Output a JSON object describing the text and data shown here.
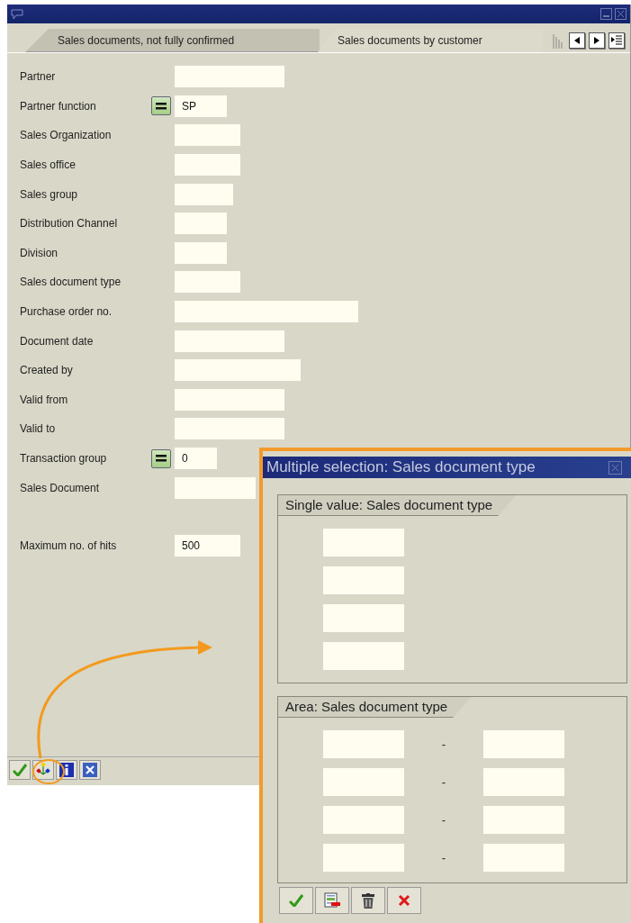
{
  "tabs": [
    {
      "label": "Sales documents, not fully confirmed",
      "selected": false
    },
    {
      "label": "Sales documents by customer",
      "selected": true
    }
  ],
  "fields": [
    {
      "label": "Partner",
      "kind": "plain"
    },
    {
      "label": "Partner function",
      "kind": "option",
      "value": "SP"
    },
    {
      "label": "Sales Organization",
      "kind": "plain"
    },
    {
      "label": "Sales office",
      "kind": "plain"
    },
    {
      "label": "Sales group",
      "kind": "plain"
    },
    {
      "label": "Distribution Channel",
      "kind": "plain"
    },
    {
      "label": "Division",
      "kind": "plain"
    },
    {
      "label": "Sales document type",
      "kind": "plain"
    },
    {
      "label": "Purchase order no.",
      "kind": "plain"
    },
    {
      "label": "Document date",
      "kind": "plain"
    },
    {
      "label": "Created by",
      "kind": "plain"
    },
    {
      "label": "Valid from",
      "kind": "plain"
    },
    {
      "label": "Valid to",
      "kind": "plain"
    },
    {
      "label": "Transaction group",
      "kind": "option",
      "value": "0"
    },
    {
      "label": "Sales Document",
      "kind": "plain"
    }
  ],
  "limit": {
    "label": "Maximum no. of hits",
    "value": "500"
  },
  "popup": {
    "title": "Multiple selection: Sales document type",
    "single": {
      "title": "Single value: Sales document type"
    },
    "area": {
      "title": "Area: Sales document type",
      "rows": [
        {
          "separator": "-"
        },
        {
          "separator": "-"
        },
        {
          "separator": "-"
        },
        {
          "separator": "-"
        }
      ]
    }
  }
}
